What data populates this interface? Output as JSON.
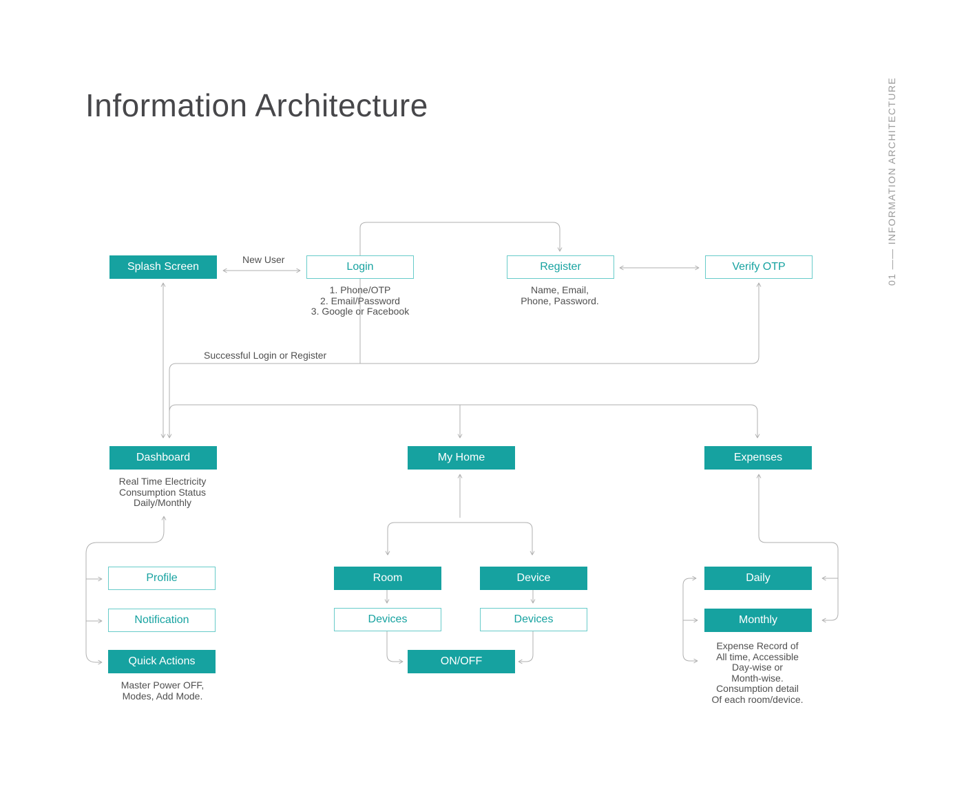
{
  "page": {
    "title": "Information Architecture",
    "side_label": "01 ―― INFORMATION ARCHITECTURE"
  },
  "colors": {
    "teal": "#16A2A0",
    "teal_border": "#66CBC9",
    "line": "#AFAFAF",
    "text": "#4F4F4F",
    "heading": "#47474A",
    "side_text": "#9B9B9B"
  },
  "flow": {
    "splash": {
      "label": "Splash Screen"
    },
    "login": {
      "label": "Login",
      "note": "1. Phone/OTP\n2. Email/Password\n3. Google or Facebook"
    },
    "register": {
      "label": "Register",
      "note": "Name, Email,\nPhone, Password."
    },
    "verify_otp": {
      "label": "Verify OTP"
    },
    "dashboard": {
      "label": "Dashboard",
      "note": "Real Time Electricity\nConsumption Status\nDaily/Monthly"
    },
    "my_home": {
      "label": "My Home"
    },
    "expenses": {
      "label": "Expenses",
      "note": "Expense Record of\nAll time, Accessible\nDay-wise or\nMonth-wise.\nConsumption detail\nOf each room/device."
    },
    "profile": {
      "label": "Profile"
    },
    "notification": {
      "label": "Notification"
    },
    "quick_actions": {
      "label": "Quick Actions",
      "note": "Master Power OFF,\nModes, Add Mode."
    },
    "room": {
      "label": "Room"
    },
    "device": {
      "label": "Device"
    },
    "room_devices": {
      "label": "Devices"
    },
    "device_devices": {
      "label": "Devices"
    },
    "on_off": {
      "label": "ON/OFF"
    },
    "daily": {
      "label": "Daily"
    },
    "monthly": {
      "label": "Monthly"
    }
  },
  "edge_labels": {
    "new_user": "New User",
    "success": "Successful Login or Register"
  }
}
